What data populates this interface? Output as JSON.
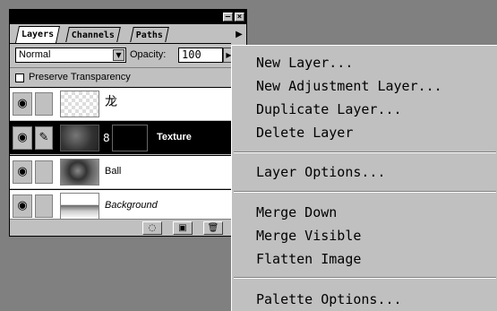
{
  "palette": {
    "tabs": [
      "Layers",
      "Channels",
      "Paths"
    ],
    "blend_mode": "Normal",
    "opacity_label": "Opacity:",
    "opacity_value": "100",
    "preserve_label": "Preserve Transparency",
    "layers": [
      {
        "name": "龙"
      },
      {
        "name": "Texture"
      },
      {
        "name": "Ball"
      },
      {
        "name": "Background"
      }
    ]
  },
  "menu": {
    "items": [
      "New Layer...",
      "New Adjustment Layer...",
      "Duplicate Layer...",
      "Delete Layer",
      "Layer Options...",
      "Merge Down",
      "Merge Visible",
      "Flatten Image",
      "Palette Options..."
    ]
  }
}
